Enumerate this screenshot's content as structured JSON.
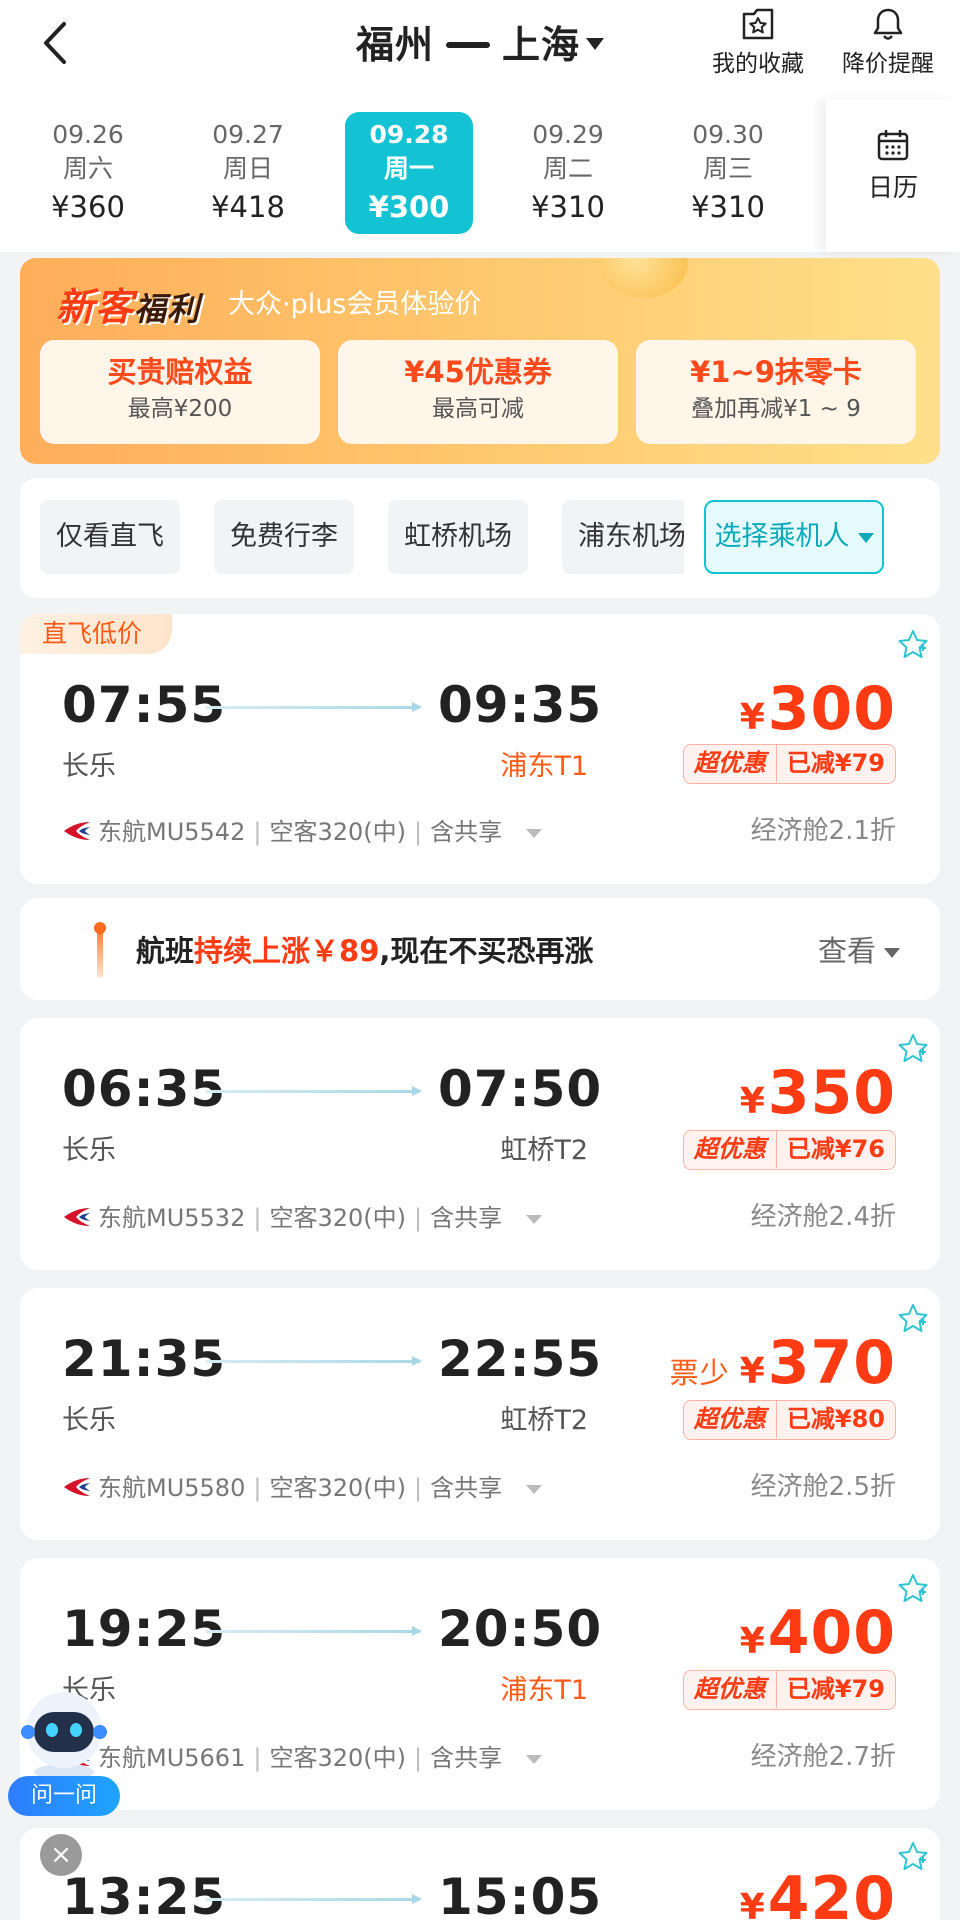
{
  "header": {
    "from": "福州",
    "to": "上海",
    "favorites_label": "我的收藏",
    "price_alert_label": "降价提醒"
  },
  "dates": [
    {
      "date": "09.26",
      "weekday": "周六",
      "price": "¥360",
      "active": false
    },
    {
      "date": "09.27",
      "weekday": "周日",
      "price": "¥418",
      "active": false
    },
    {
      "date": "09.28",
      "weekday": "周一",
      "price": "¥300",
      "active": true
    },
    {
      "date": "09.29",
      "weekday": "周二",
      "price": "¥310",
      "active": false
    },
    {
      "date": "09.30",
      "weekday": "周三",
      "price": "¥310",
      "active": false
    }
  ],
  "calendar_label": "日历",
  "promo": {
    "title_a": "新客",
    "title_b": "福利",
    "subtitle": "大众·plus会员体验价",
    "cards": [
      {
        "title": "买贵赔权益",
        "sub": "最高¥200"
      },
      {
        "title": "¥45优惠券",
        "sub": "最高可减"
      },
      {
        "title": "¥1~9抹零卡",
        "sub": "叠加再减¥1 ~ 9"
      }
    ]
  },
  "filters": {
    "chips": [
      "仅看直飞",
      "免费行李",
      "虹桥机场",
      "浦东机场"
    ],
    "passenger": "选择乘机人"
  },
  "flights": [
    {
      "tag": "直飞低价",
      "dep_time": "07:55",
      "arr_time": "09:35",
      "dep_airport": "长乐",
      "arr_airport": "浦东T1",
      "arr_highlight": true,
      "price": "300",
      "few_seats": "",
      "badge1": "超优惠",
      "badge2": "已减¥79",
      "airline": "东航MU5542",
      "aircraft": "空客320(中)",
      "share": "含共享",
      "cabin": "经济舱2.1折"
    },
    {
      "tag": "",
      "dep_time": "06:35",
      "arr_time": "07:50",
      "dep_airport": "长乐",
      "arr_airport": "虹桥T2",
      "arr_highlight": false,
      "price": "350",
      "few_seats": "",
      "badge1": "超优惠",
      "badge2": "已减¥76",
      "airline": "东航MU5532",
      "aircraft": "空客320(中)",
      "share": "含共享",
      "cabin": "经济舱2.4折"
    },
    {
      "tag": "",
      "dep_time": "21:35",
      "arr_time": "22:55",
      "dep_airport": "长乐",
      "arr_airport": "虹桥T2",
      "arr_highlight": false,
      "price": "370",
      "few_seats": "票少",
      "badge1": "超优惠",
      "badge2": "已减¥80",
      "airline": "东航MU5580",
      "aircraft": "空客320(中)",
      "share": "含共享",
      "cabin": "经济舱2.5折"
    },
    {
      "tag": "",
      "dep_time": "19:25",
      "arr_time": "20:50",
      "dep_airport": "长乐",
      "arr_airport": "浦东T1",
      "arr_highlight": true,
      "price": "400",
      "few_seats": "",
      "badge1": "超优惠",
      "badge2": "已减¥79",
      "airline": "东航MU5661",
      "aircraft": "空客320(中)",
      "share": "含共享",
      "cabin": "经济舱2.7折"
    },
    {
      "tag": "",
      "dep_time": "13:25",
      "arr_time": "15:05",
      "dep_airport": "",
      "arr_airport": "",
      "arr_highlight": false,
      "price": "420",
      "few_seats": "",
      "badge1": "",
      "badge2": "",
      "airline": "",
      "aircraft": "",
      "share": "",
      "cabin": ""
    }
  ],
  "price_alert": {
    "prefix": "航班",
    "highlight": "持续上涨￥89",
    "suffix": ",现在不买恐再涨",
    "action": "查看"
  },
  "assistant": {
    "ask_label": "问一问",
    "close_label": "×"
  },
  "currency_symbol": "¥",
  "sep": "|",
  "colors": {
    "accent": "#13c3d3",
    "price": "#ff3b13",
    "promo_orange": "#ffad5a"
  }
}
